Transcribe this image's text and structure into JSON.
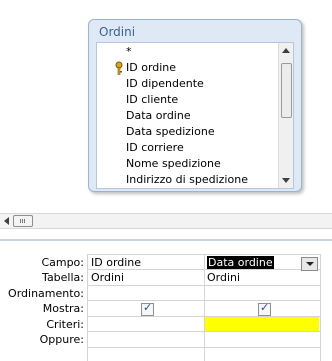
{
  "table_box": {
    "title": "Ordini",
    "fields": [
      "*",
      "ID ordine",
      "ID dipendente",
      "ID cliente",
      "Data ordine",
      "Data spedizione",
      "ID corriere",
      "Nome spedizione",
      "Indirizzo di spedizione"
    ],
    "primary_key_field": "ID ordine"
  },
  "grid": {
    "row_labels": [
      "Campo:",
      "Tabella:",
      "Ordinamento:",
      "Mostra:",
      "Criteri:",
      "Oppure:"
    ],
    "columns": [
      {
        "campo": "ID ordine",
        "tabella": "Ordini",
        "mostra": true
      },
      {
        "campo": "Data ordine",
        "tabella": "Ordini",
        "mostra": true,
        "selected": true,
        "criteri_highlight": "#ffff00"
      }
    ]
  },
  "icons": {
    "key": "key-icon",
    "dropdown": "chevron-down-icon",
    "check": "checkmark-icon"
  }
}
